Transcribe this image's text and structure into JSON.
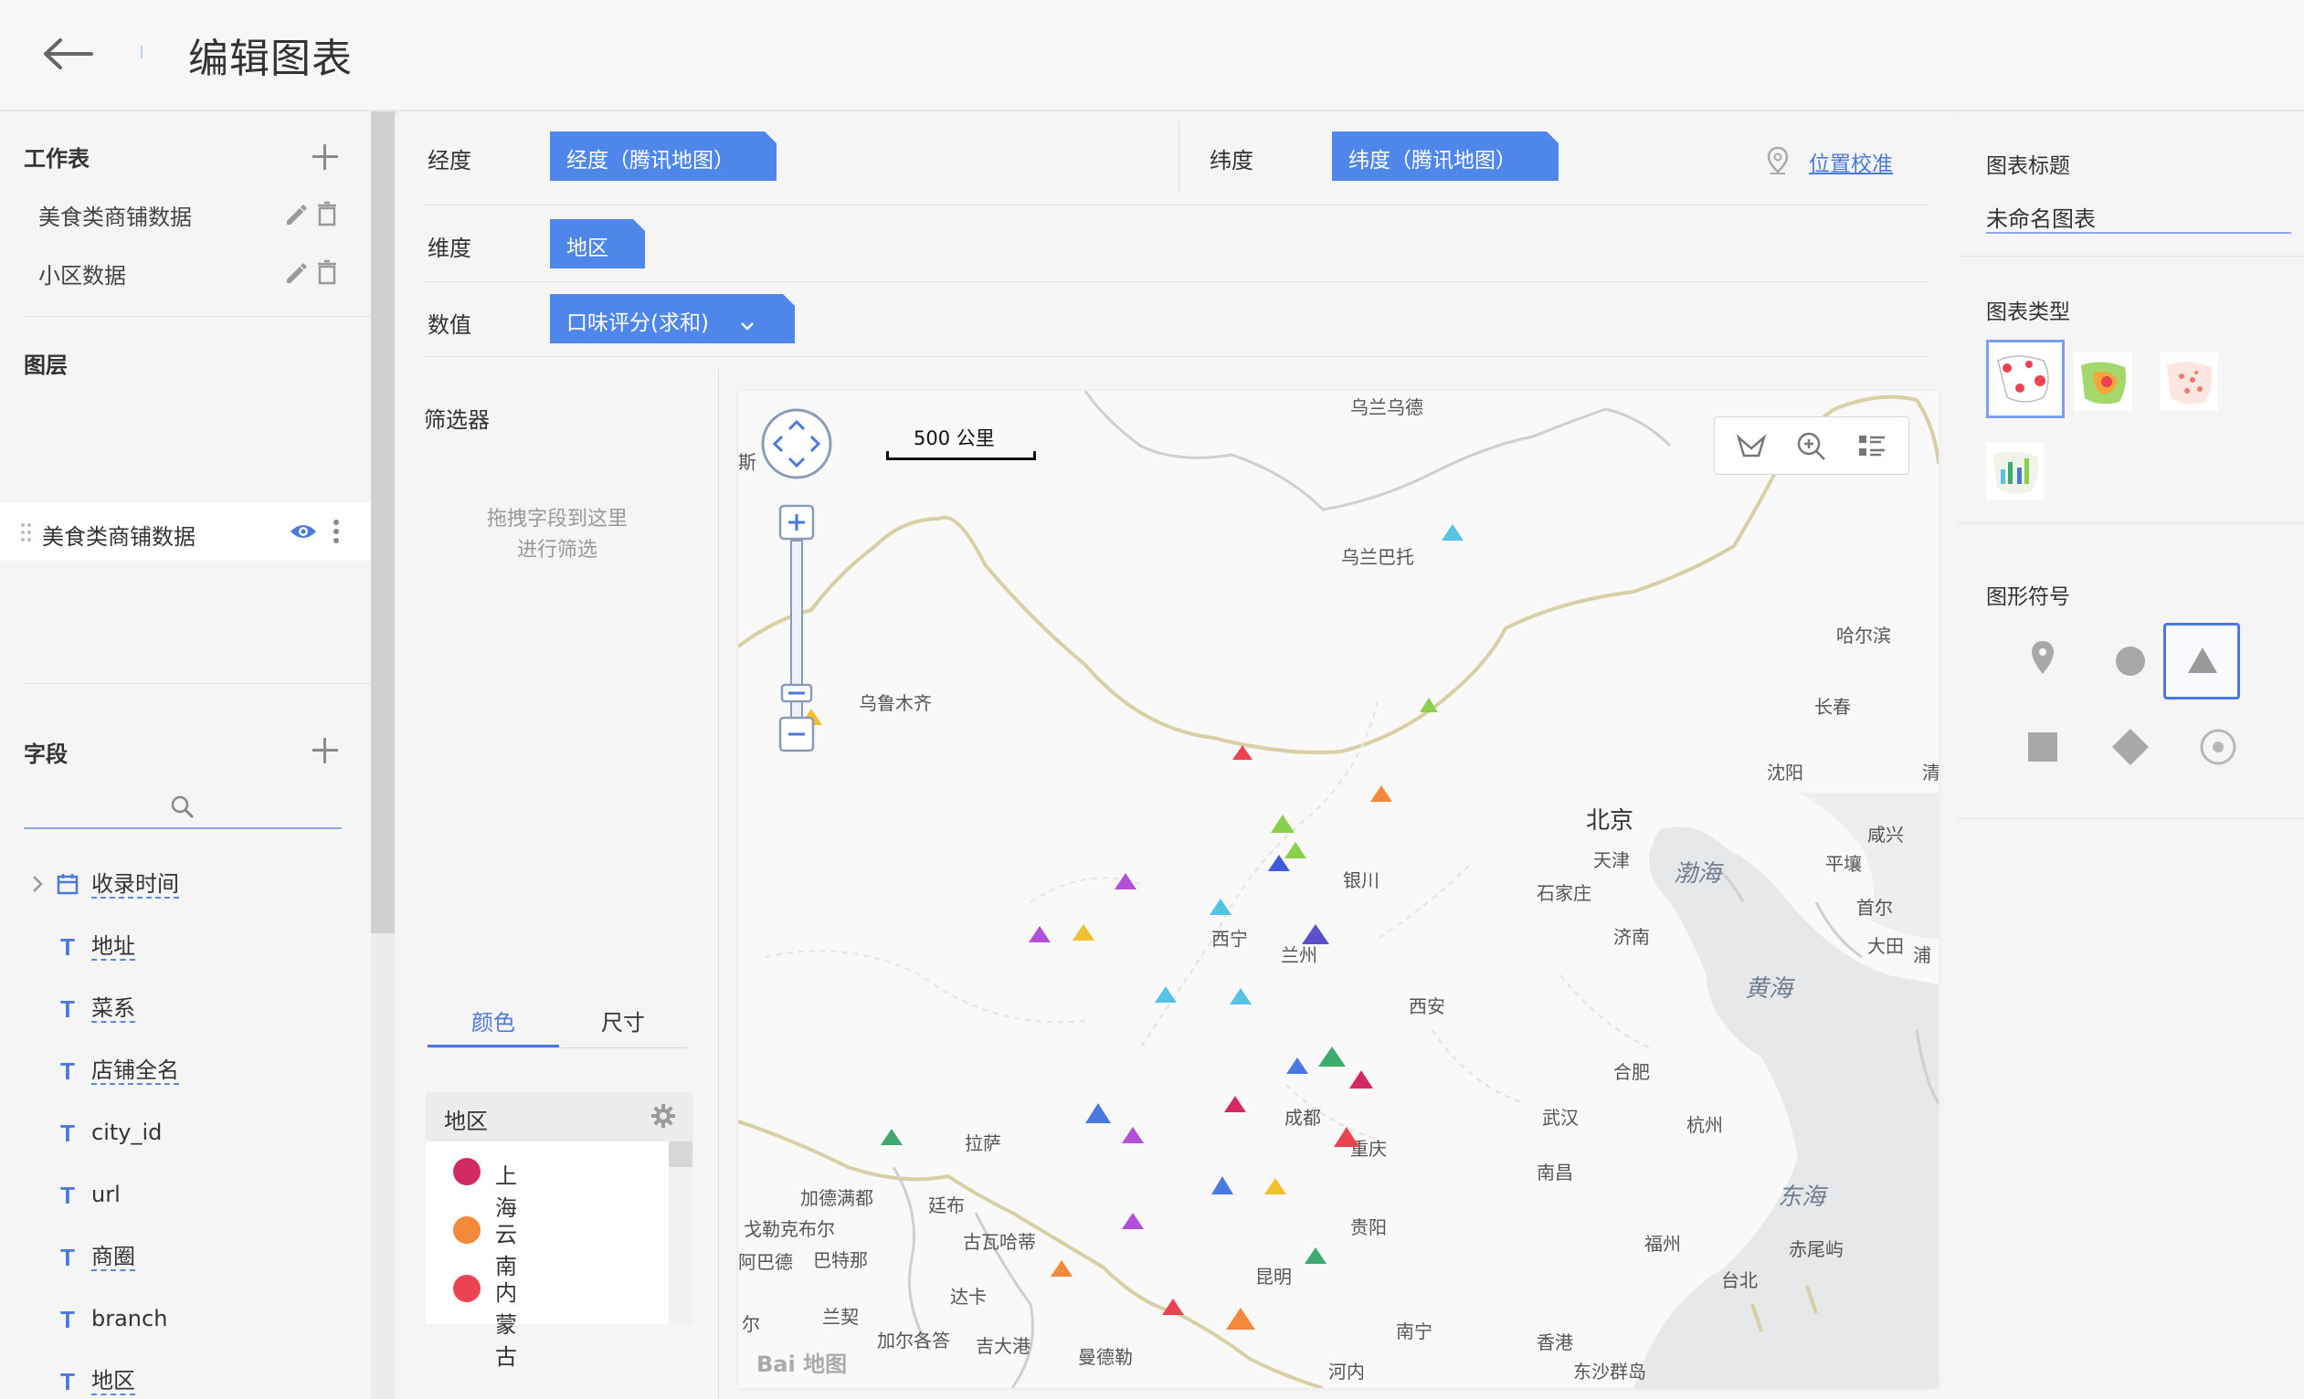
{
  "header": {
    "title": "编辑图表"
  },
  "sidebar": {
    "worksheet_title": "工作表",
    "worksheets": [
      {
        "label": "美食类商铺数据"
      },
      {
        "label": "小区数据"
      }
    ],
    "layers_title": "图层",
    "layers": [
      {
        "label": "美食类商铺数据"
      }
    ],
    "fields_title": "字段",
    "fields": [
      {
        "type": "date",
        "label": "收录时间"
      },
      {
        "type": "T",
        "label": "地址"
      },
      {
        "type": "T",
        "label": "菜系"
      },
      {
        "type": "T",
        "label": "店铺全名"
      },
      {
        "type": "T",
        "label": "city_id"
      },
      {
        "type": "T",
        "label": "url"
      },
      {
        "type": "T",
        "label": "商圈"
      },
      {
        "type": "T",
        "label": "branch"
      },
      {
        "type": "T",
        "label": "地区"
      }
    ]
  },
  "config": {
    "longitude_label": "经度",
    "longitude_value": "经度（腾讯地图）",
    "latitude_label": "纬度",
    "latitude_value": "纬度（腾讯地图）",
    "calibrate_link": "位置校准",
    "dimension_label": "维度",
    "dimension_value": "地区",
    "value_label": "数值",
    "value_value": "口味评分(求和)",
    "filter_title": "筛选器",
    "filter_hint_1": "拖拽字段到这里",
    "filter_hint_2": "进行筛选",
    "tab_color": "颜色",
    "tab_size": "尺寸",
    "legend_title": "地区",
    "legend_items": [
      {
        "label": "上海",
        "color": "#d42a64"
      },
      {
        "label": "云南",
        "color": "#f5883a"
      },
      {
        "label": "内蒙古",
        "color": "#ec4352"
      }
    ]
  },
  "map": {
    "scale_label": "500 公里",
    "places": [
      {
        "name": "乌兰乌德"
      },
      {
        "name": "乌兰巴托"
      },
      {
        "name": "哈尔滨"
      },
      {
        "name": "长春"
      },
      {
        "name": "乌鲁木齐"
      },
      {
        "name": "沈阳"
      },
      {
        "name": "北京"
      },
      {
        "name": "咸兴"
      },
      {
        "name": "天津"
      },
      {
        "name": "平壤"
      },
      {
        "name": "渤海"
      },
      {
        "name": "石家庄"
      },
      {
        "name": "首尔"
      },
      {
        "name": "银川"
      },
      {
        "name": "大田"
      },
      {
        "name": "济南"
      },
      {
        "name": "西宁"
      },
      {
        "name": "兰州"
      },
      {
        "name": "黄海"
      },
      {
        "name": "西安"
      },
      {
        "name": "合肥"
      },
      {
        "name": "武汉"
      },
      {
        "name": "杭州"
      },
      {
        "name": "成都"
      },
      {
        "name": "拉萨"
      },
      {
        "name": "重庆"
      },
      {
        "name": "加德满都"
      },
      {
        "name": "廷布"
      },
      {
        "name": "南昌"
      },
      {
        "name": "东海"
      },
      {
        "name": "戈勒克布尔"
      },
      {
        "name": "古瓦哈蒂"
      },
      {
        "name": "阿巴德"
      },
      {
        "name": "巴特那"
      },
      {
        "name": "贵阳"
      },
      {
        "name": "福州"
      },
      {
        "name": "赤尾屿"
      },
      {
        "name": "昆明"
      },
      {
        "name": "达卡"
      },
      {
        "name": "台北"
      },
      {
        "name": "兰契"
      },
      {
        "name": "加尔各答"
      },
      {
        "name": "吉大港"
      },
      {
        "name": "曼德勒"
      },
      {
        "name": "南宁"
      },
      {
        "name": "香港"
      },
      {
        "name": "河内"
      },
      {
        "name": "东沙群岛"
      },
      {
        "name": "浦"
      },
      {
        "name": "清"
      },
      {
        "name": "斯"
      },
      {
        "name": "尔"
      }
    ],
    "markers_colors": [
      "#f5883a",
      "#d42a64",
      "#ec4352",
      "#3c5bd6",
      "#56c3e6",
      "#5ba7f0",
      "#8bd04a",
      "#3bab6e",
      "#b14fd8",
      "#f2c02c",
      "#4a78e0",
      "#5d4fc8"
    ],
    "baidu_label": "Bai 地图"
  },
  "right": {
    "chart_title_label": "图表标题",
    "chart_title_value": "未命名图表",
    "chart_type_label": "图表类型",
    "symbol_label": "图形符号"
  }
}
